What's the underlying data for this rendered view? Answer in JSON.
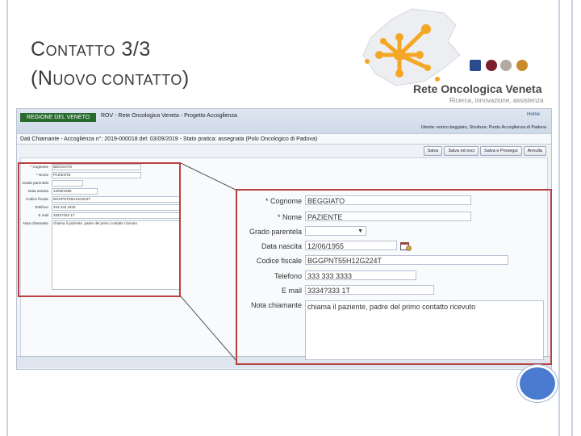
{
  "slide": {
    "title_line1_cap": "C",
    "title_line1_rest": "ONTATTO",
    "title_line1_num": "3/3",
    "title_line2_open": "(",
    "title_line2_cap": "N",
    "title_line2_rest": "UOVO CONTATTO",
    "title_line2_close": ")"
  },
  "logo": {
    "name": "Rete Oncologica Veneta",
    "tagline": "Ricerca, innovazione, assistenza"
  },
  "app": {
    "region_label": "REGIONE DEL VENETO",
    "app_title": "ROV - Rete Oncologica Veneta - Progetto Accoglienza",
    "home_link": "Home",
    "user_info": "Utente: enrico.beggiato, Struttura: Punto Accoglienza di Padova",
    "pratica_status": "Dati Chiamante - Accoglienza n°: 2019-000018 del: 03/09/2019 - Stato pratica: assegnata (Polo Oncologico di Padova)",
    "toolbar": [
      "Salva",
      "Salva ed esci",
      "Salva e Prosegui",
      "Annulla"
    ]
  },
  "form": {
    "cognome_label": "* Cognome",
    "cognome_value": "BEGGIATO",
    "nome_label": "* Nome",
    "nome_value": "PAZIENTE",
    "grado_label": "Grado parentela",
    "grado_value": "",
    "data_label": "Data nascita",
    "data_value": "12/06/1955",
    "cf_label": "Codice fiscale",
    "cf_value": "BGGPNT55H12G224T",
    "tel_label": "Telefono",
    "tel_value": "333 333 3333",
    "email_label": "E mail",
    "email_value": "3334?333 1T",
    "nota_label": "Nota chiamante",
    "nota_value": "chiama il paziente, padre del primo contatto ricevuto"
  },
  "colors": {
    "highlight": "#b84141",
    "accent": "#4a7bd0",
    "logo_orange": "#f5a623"
  }
}
